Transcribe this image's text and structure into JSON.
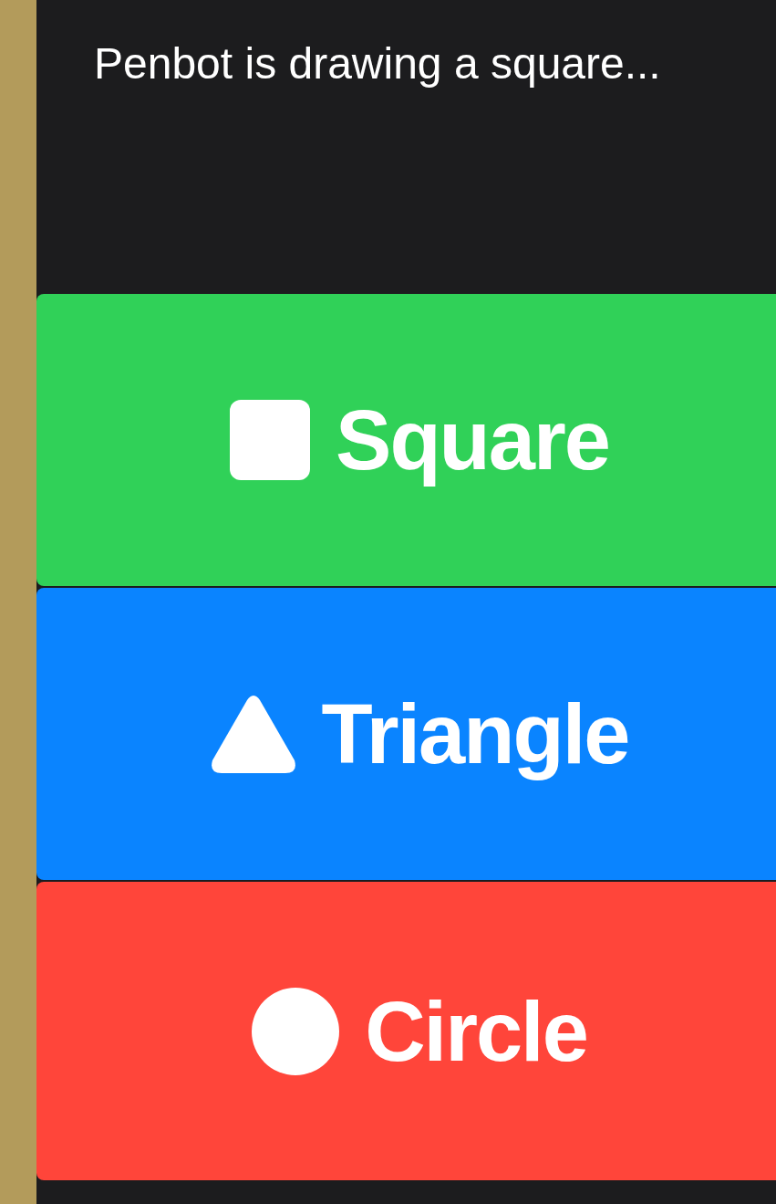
{
  "status": "Penbot is drawing a square...",
  "buttons": [
    {
      "kind": "square",
      "label": "Square",
      "color": "#30d158"
    },
    {
      "kind": "triangle",
      "label": "Triangle",
      "color": "#0a84ff"
    },
    {
      "kind": "circle",
      "label": "Circle",
      "color": "#ff453a"
    }
  ]
}
